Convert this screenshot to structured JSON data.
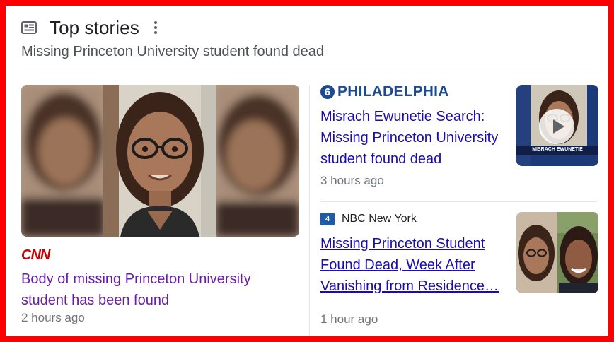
{
  "header": {
    "title": "Top stories",
    "subtitle": "Missing Princeton University student found dead",
    "icon": "newspaper-icon"
  },
  "lead_story": {
    "source": "CNN",
    "headline": "Body of missing Princeton University student has been found",
    "time": "2 hours ago"
  },
  "stories": [
    {
      "source": "PHILADELPHIA",
      "source_mark": "6",
      "headline": "Misrach Ewunetie Search: Missing Princeton University student found dead",
      "time": "3 hours ago",
      "thumb_caption": "MISRACH EWUNETIE",
      "has_video": true
    },
    {
      "source": "NBC New York",
      "source_mark": "4",
      "headline": "Missing Princeton Student Found Dead, Week After Vanishing from Residence…",
      "time": "1 hour ago"
    }
  ],
  "colors": {
    "frame": "#ff0000",
    "visited_link": "#681da8",
    "link": "#1a0dab",
    "cnn_red": "#cc0000",
    "abc_blue": "#1e4b8f"
  }
}
